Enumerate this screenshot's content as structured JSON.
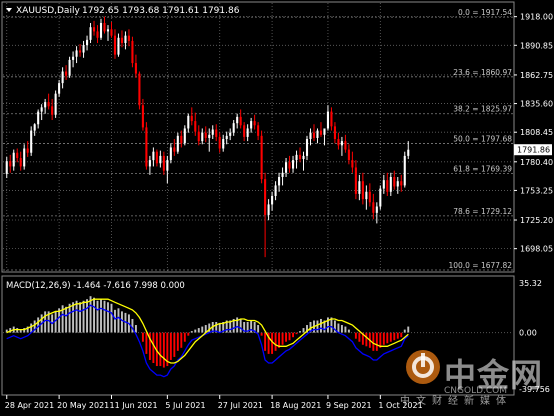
{
  "header": {
    "symbol": "XAUUSD,Daily",
    "ohlc": "1792.65 1793.68 1791.61 1791.86"
  },
  "price_axis": {
    "ticks": [
      "1918.00",
      "1890.85",
      "1862.75",
      "1835.60",
      "1808.45",
      "1780.40",
      "1753.25",
      "1725.20",
      "1698.05"
    ],
    "ticks_num": [
      1918.0,
      1890.85,
      1862.75,
      1835.6,
      1808.45,
      1780.4,
      1753.25,
      1725.2,
      1698.05
    ],
    "current_label": "1791.86",
    "current_value": 1791.86
  },
  "fibonacci": [
    {
      "label": "0.0 = 1917.54",
      "value": 1917.54
    },
    {
      "label": "23.6 = 1860.97",
      "value": 1860.97
    },
    {
      "label": "38.2 = 1825.97",
      "value": 1825.97
    },
    {
      "label": "50.0 = 1797.68",
      "value": 1797.68
    },
    {
      "label": "61.8 = 1769.39",
      "value": 1769.39
    },
    {
      "label": "78.6 = 1729.12",
      "value": 1729.12
    },
    {
      "label": "100.0 = 1677.82",
      "value": 1677.82
    }
  ],
  "macd": {
    "label": "MACD(12,26,9) -1.464 -7.616 7.998 0.000",
    "axis_top": "35.32",
    "axis_zero": "0.00",
    "axis_bottom": "-39.756",
    "axis_top_num": 35.32,
    "axis_bottom_num": -39.756
  },
  "x_axis": {
    "ticks": [
      "28 Apr 2021",
      "20 May 2021",
      "11 Jun 2021",
      "5 Jul 2021",
      "27 Jul 2021",
      "18 Aug 2021",
      "9 Sep 2021",
      "1 Oct 2021"
    ]
  },
  "watermark": {
    "brand_cn": "中金网",
    "brand_en": "CNGOLD.COM",
    "tagline": "中文财经新媒体"
  },
  "colors": {
    "background": "#000000",
    "bull_candle": "#ffffff",
    "bear_candle": "#ff0000",
    "macd_positive": "#c0c0c0",
    "macd_negative": "#ff0000",
    "macd_line": "#0000ff",
    "signal_line": "#ffff00",
    "grid": "#646464",
    "fib": "#808080",
    "axis_text": "#ffffff"
  },
  "chart_data": [
    {
      "type": "candlestick",
      "title": "XAUUSD,Daily",
      "ylim": [
        1677.82,
        1930
      ],
      "x": [
        "28 Apr 2021",
        "20 May 2021",
        "11 Jun 2021",
        "5 Jul 2021",
        "27 Jul 2021",
        "18 Aug 2021",
        "9 Sep 2021",
        "1 Oct 2021"
      ],
      "ohlc": [
        [
          1769,
          1785,
          1765,
          1781
        ],
        [
          1781,
          1787,
          1770,
          1776
        ],
        [
          1776,
          1792,
          1772,
          1789
        ],
        [
          1789,
          1793,
          1780,
          1784
        ],
        [
          1784,
          1790,
          1772,
          1776
        ],
        [
          1776,
          1797,
          1773,
          1793
        ],
        [
          1793,
          1800,
          1785,
          1789
        ],
        [
          1789,
          1814,
          1786,
          1810
        ],
        [
          1810,
          1817,
          1805,
          1816
        ],
        [
          1816,
          1830,
          1812,
          1828
        ],
        [
          1828,
          1835,
          1820,
          1832
        ],
        [
          1832,
          1840,
          1826,
          1837
        ],
        [
          1837,
          1845,
          1830,
          1833
        ],
        [
          1833,
          1840,
          1820,
          1825
        ],
        [
          1825,
          1848,
          1822,
          1845
        ],
        [
          1845,
          1858,
          1842,
          1855
        ],
        [
          1855,
          1870,
          1850,
          1866
        ],
        [
          1866,
          1872,
          1858,
          1862
        ],
        [
          1862,
          1880,
          1860,
          1877
        ],
        [
          1877,
          1885,
          1870,
          1880
        ],
        [
          1880,
          1890,
          1874,
          1886
        ],
        [
          1886,
          1892,
          1880,
          1884
        ],
        [
          1884,
          1895,
          1879,
          1891
        ],
        [
          1891,
          1900,
          1886,
          1896
        ],
        [
          1896,
          1912,
          1893,
          1908
        ],
        [
          1908,
          1914,
          1900,
          1904
        ],
        [
          1904,
          1910,
          1893,
          1898
        ],
        [
          1898,
          1916,
          1896,
          1912
        ],
        [
          1912,
          1918,
          1902,
          1904
        ],
        [
          1904,
          1910,
          1895,
          1906
        ],
        [
          1906,
          1913,
          1898,
          1900
        ],
        [
          1900,
          1906,
          1878,
          1882
        ],
        [
          1882,
          1902,
          1880,
          1898
        ],
        [
          1898,
          1905,
          1889,
          1893
        ],
        [
          1893,
          1904,
          1887,
          1900
        ],
        [
          1900,
          1906,
          1890,
          1895
        ],
        [
          1895,
          1899,
          1870,
          1874
        ],
        [
          1874,
          1882,
          1860,
          1864
        ],
        [
          1864,
          1866,
          1830,
          1834
        ],
        [
          1834,
          1840,
          1810,
          1813
        ],
        [
          1813,
          1818,
          1773,
          1776
        ],
        [
          1776,
          1786,
          1768,
          1782
        ],
        [
          1782,
          1794,
          1776,
          1790
        ],
        [
          1790,
          1792,
          1776,
          1779
        ],
        [
          1779,
          1791,
          1775,
          1786
        ],
        [
          1786,
          1790,
          1768,
          1772
        ],
        [
          1772,
          1786,
          1760,
          1782
        ],
        [
          1782,
          1798,
          1779,
          1794
        ],
        [
          1794,
          1802,
          1786,
          1790
        ],
        [
          1790,
          1808,
          1788,
          1805
        ],
        [
          1805,
          1810,
          1794,
          1798
        ],
        [
          1798,
          1815,
          1796,
          1812
        ],
        [
          1812,
          1826,
          1808,
          1824
        ],
        [
          1824,
          1832,
          1815,
          1819
        ],
        [
          1819,
          1827,
          1805,
          1809
        ],
        [
          1809,
          1815,
          1796,
          1800
        ],
        [
          1800,
          1812,
          1797,
          1808
        ],
        [
          1808,
          1814,
          1799,
          1803
        ],
        [
          1803,
          1812,
          1790,
          1806
        ],
        [
          1806,
          1815,
          1802,
          1811
        ],
        [
          1811,
          1816,
          1800,
          1804
        ],
        [
          1804,
          1808,
          1789,
          1793
        ],
        [
          1793,
          1806,
          1790,
          1802
        ],
        [
          1802,
          1809,
          1797,
          1805
        ],
        [
          1805,
          1812,
          1801,
          1808
        ],
        [
          1808,
          1820,
          1805,
          1817
        ],
        [
          1817,
          1826,
          1812,
          1823
        ],
        [
          1823,
          1830,
          1812,
          1815
        ],
        [
          1815,
          1818,
          1800,
          1804
        ],
        [
          1804,
          1816,
          1800,
          1812
        ],
        [
          1812,
          1822,
          1808,
          1819
        ],
        [
          1819,
          1825,
          1811,
          1815
        ],
        [
          1815,
          1818,
          1801,
          1805
        ],
        [
          1805,
          1810,
          1760,
          1764
        ],
        [
          1764,
          1770,
          1690,
          1730
        ],
        [
          1730,
          1745,
          1725,
          1740
        ],
        [
          1740,
          1752,
          1734,
          1748
        ],
        [
          1748,
          1762,
          1744,
          1758
        ],
        [
          1758,
          1770,
          1752,
          1766
        ],
        [
          1766,
          1775,
          1758,
          1770
        ],
        [
          1770,
          1784,
          1766,
          1780
        ],
        [
          1780,
          1786,
          1770,
          1774
        ],
        [
          1774,
          1786,
          1770,
          1782
        ],
        [
          1782,
          1791,
          1774,
          1787
        ],
        [
          1787,
          1794,
          1780,
          1783
        ],
        [
          1783,
          1790,
          1772,
          1786
        ],
        [
          1786,
          1805,
          1782,
          1802
        ],
        [
          1802,
          1812,
          1796,
          1808
        ],
        [
          1808,
          1816,
          1800,
          1803
        ],
        [
          1803,
          1812,
          1798,
          1810
        ],
        [
          1810,
          1818,
          1804,
          1806
        ],
        [
          1806,
          1810,
          1796,
          1812
        ],
        [
          1812,
          1834,
          1810,
          1828
        ],
        [
          1828,
          1832,
          1810,
          1814
        ],
        [
          1814,
          1818,
          1798,
          1802
        ],
        [
          1802,
          1808,
          1792,
          1796
        ],
        [
          1796,
          1804,
          1786,
          1800
        ],
        [
          1800,
          1806,
          1789,
          1792
        ],
        [
          1792,
          1797,
          1778,
          1782
        ],
        [
          1782,
          1790,
          1770,
          1775
        ],
        [
          1775,
          1782,
          1745,
          1750
        ],
        [
          1750,
          1768,
          1744,
          1762
        ],
        [
          1762,
          1770,
          1740,
          1745
        ],
        [
          1745,
          1758,
          1735,
          1752
        ],
        [
          1752,
          1760,
          1738,
          1742
        ],
        [
          1742,
          1750,
          1726,
          1732
        ],
        [
          1732,
          1742,
          1722,
          1738
        ],
        [
          1738,
          1758,
          1735,
          1755
        ],
        [
          1755,
          1768,
          1750,
          1763
        ],
        [
          1763,
          1770,
          1748,
          1752
        ],
        [
          1752,
          1770,
          1748,
          1766
        ],
        [
          1766,
          1772,
          1754,
          1757
        ],
        [
          1757,
          1766,
          1750,
          1762
        ],
        [
          1762,
          1768,
          1752,
          1758
        ],
        [
          1758,
          1790,
          1756,
          1786
        ],
        [
          1786,
          1800,
          1783,
          1791.86
        ]
      ]
    },
    {
      "type": "bar",
      "title": "MACD(12,26,9) -1.464 -7.616 7.998 0.000",
      "ylim": [
        -39.756,
        35.32
      ],
      "series": [
        {
          "name": "MACD",
          "values": [
            2,
            3,
            4,
            3,
            2,
            3,
            4,
            6,
            8,
            10,
            12,
            14,
            14,
            12,
            14,
            16,
            18,
            17,
            19,
            20,
            21,
            20,
            21,
            22,
            24,
            23,
            21,
            22,
            21,
            20,
            19,
            15,
            16,
            14,
            13,
            12,
            9,
            5,
            0,
            -6,
            -14,
            -18,
            -20,
            -22,
            -22,
            -23,
            -22,
            -18,
            -16,
            -12,
            -10,
            -6,
            -2,
            1,
            2,
            3,
            4,
            5,
            6,
            7,
            7,
            6,
            7,
            8,
            8,
            9,
            10,
            9,
            7,
            7,
            8,
            7,
            5,
            -2,
            -12,
            -14,
            -14,
            -12,
            -10,
            -8,
            -6,
            -5,
            -3,
            -1,
            1,
            3,
            5,
            7,
            8,
            8,
            9,
            8,
            10,
            10,
            8,
            6,
            5,
            4,
            2,
            0,
            -4,
            -6,
            -8,
            -9,
            -10,
            -12,
            -12,
            -10,
            -8,
            -7,
            -6,
            -5,
            -4,
            -3,
            2,
            4
          ]
        },
        {
          "name": "Signal",
          "values": [
            0,
            1,
            2,
            2,
            2,
            2,
            3,
            4,
            5,
            7,
            9,
            11,
            12,
            13,
            14,
            14,
            15,
            16,
            17,
            18,
            19,
            19,
            20,
            20,
            21,
            22,
            22,
            22,
            22,
            22,
            21,
            20,
            19,
            18,
            17,
            16,
            15,
            13,
            10,
            6,
            1,
            -4,
            -8,
            -12,
            -15,
            -17,
            -19,
            -20,
            -20,
            -19,
            -17,
            -15,
            -12,
            -9,
            -6,
            -4,
            -2,
            0,
            2,
            4,
            5,
            6,
            6,
            7,
            7,
            8,
            8,
            9,
            9,
            8,
            8,
            8,
            7,
            5,
            1,
            -3,
            -6,
            -8,
            -9,
            -9,
            -9,
            -8,
            -7,
            -5,
            -3,
            -1,
            1,
            3,
            4,
            5,
            6,
            7,
            8,
            9,
            9,
            8,
            8,
            7,
            6,
            5,
            3,
            1,
            -1,
            -3,
            -5,
            -7,
            -8,
            -9,
            -9,
            -9,
            -8,
            -7,
            -6,
            -5,
            -3,
            -1
          ]
        }
      ]
    }
  ]
}
